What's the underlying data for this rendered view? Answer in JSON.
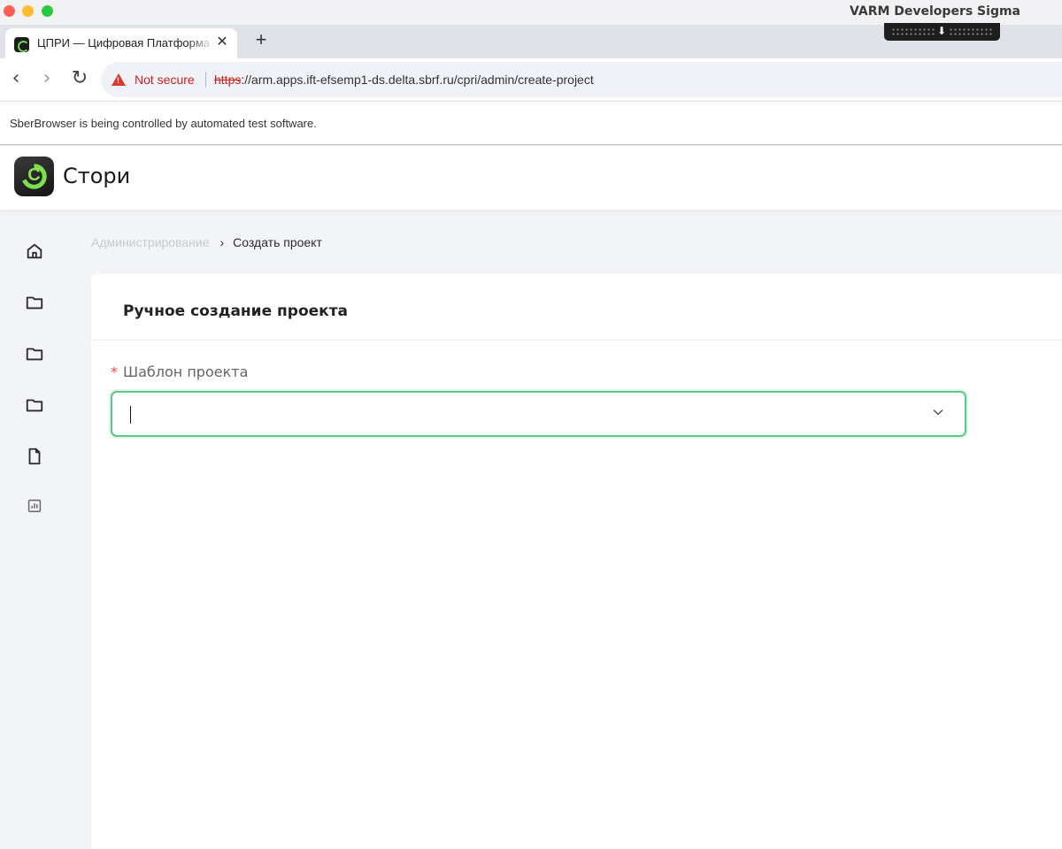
{
  "window": {
    "app_title": "VARM Developers Sigma"
  },
  "browser": {
    "tab": {
      "title": "ЦПРИ — Цифровая Платформа",
      "close_glyph": "✕"
    },
    "new_tab_glyph": "+",
    "nav": {
      "back_glyph": "‹",
      "forward_glyph": "›",
      "reload_glyph": "↻"
    },
    "omnibox": {
      "security_label": "Not secure",
      "url_scheme": "https",
      "url_rest": "://arm.apps.ift-efsemp1-ds.delta.sbrf.ru/cpri/admin/create-project"
    },
    "infobar_text": "SberBrowser is being controlled by automated test software."
  },
  "header": {
    "app_name": "Стори"
  },
  "sidebar": {
    "items": [
      {
        "icon": "home-icon"
      },
      {
        "icon": "folder-icon"
      },
      {
        "icon": "folder-icon"
      },
      {
        "icon": "folder-icon"
      },
      {
        "icon": "document-icon"
      },
      {
        "icon": "chart-icon"
      }
    ]
  },
  "breadcrumb": {
    "parent": "Администрирование",
    "separator": "›",
    "current": "Создать проект"
  },
  "form": {
    "title": "Ручное создание проекта",
    "template_field": {
      "required_mark": "*",
      "label": "Шаблон проекта",
      "value": ""
    }
  },
  "colors": {
    "accent_green": "#5ac68a",
    "required_red": "#e5484d",
    "not_secure_red": "#c5221f"
  }
}
